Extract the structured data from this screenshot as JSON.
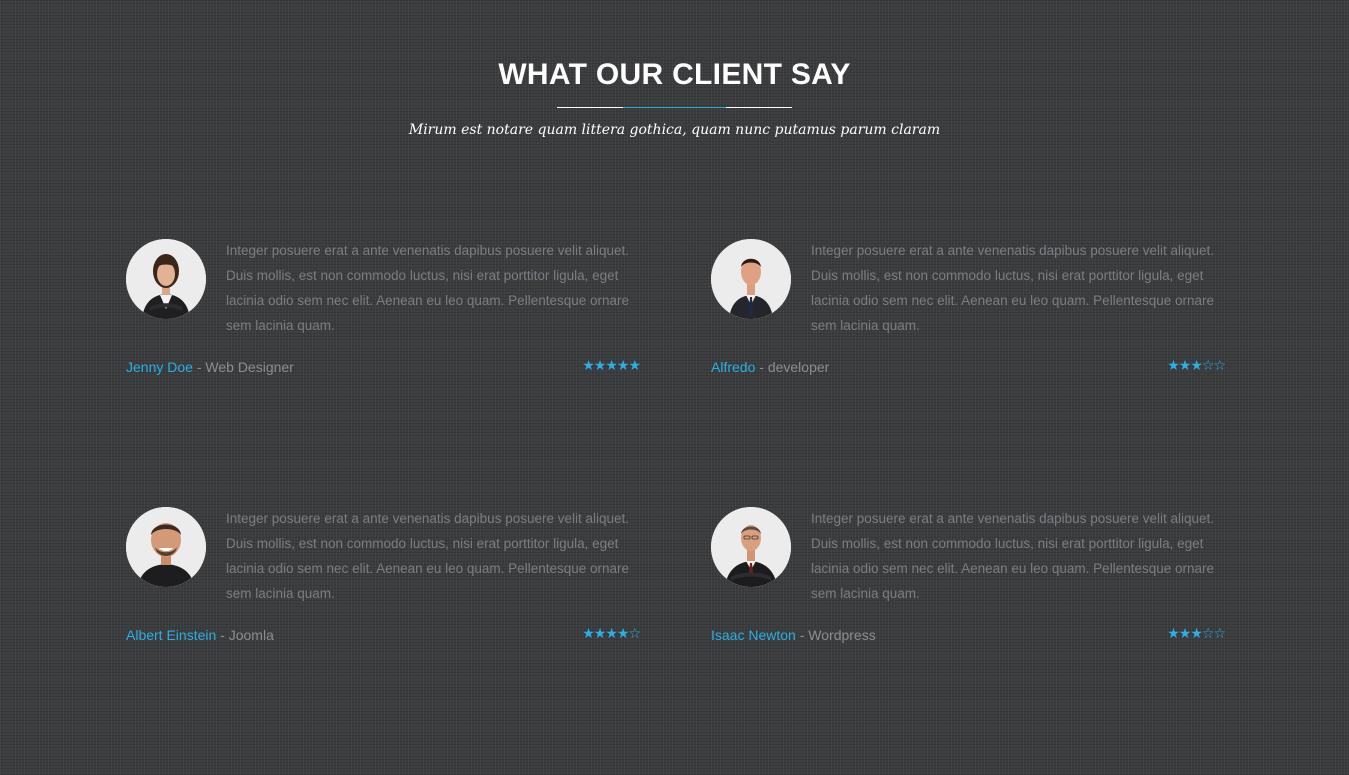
{
  "header": {
    "title": "WHAT OUR CLIENT SAY",
    "subtitle": "Mirum est notare quam littera gothica, quam nunc putamus parum claram"
  },
  "colors": {
    "accent": "#2ab0e4",
    "background": "#3b3c3e",
    "body_text": "#7a7e84"
  },
  "testimonials": [
    {
      "quote": "Integer posuere erat a ante venenatis dapibus posuere velit aliquet. Duis mollis, est non commodo luctus, nisi erat porttitor ligula, eget lacinia odio sem nec elit. Aenean eu leo quam. Pellentesque ornare sem lacinia quam.",
      "name": "Jenny Doe",
      "separator": " - ",
      "role": "Web Designer",
      "rating": 5,
      "rating_max": 5,
      "stars": "★★★★★",
      "avatar_icon": "businesswoman-avatar-icon"
    },
    {
      "quote": "Integer posuere erat a ante venenatis dapibus posuere velit aliquet. Duis mollis, est non commodo luctus, nisi erat porttitor ligula, eget lacinia odio sem nec elit. Aenean eu leo quam. Pellentesque ornare sem lacinia quam.",
      "name": "Alfredo",
      "separator": " - ",
      "role": "developer",
      "rating": 3,
      "rating_max": 5,
      "stars": "★★★☆☆",
      "avatar_icon": "businessman-suit-avatar-icon"
    },
    {
      "quote": "Integer posuere erat a ante venenatis dapibus posuere velit aliquet. Duis mollis, est non commodo luctus, nisi erat porttitor ligula, eget lacinia odio sem nec elit. Aenean eu leo quam. Pellentesque ornare sem lacinia quam.",
      "name": "Albert Einstein",
      "separator": " - ",
      "role": "Joomla",
      "rating": 4,
      "rating_max": 5,
      "stars": "★★★★☆",
      "avatar_icon": "smiling-man-avatar-icon"
    },
    {
      "quote": "Integer posuere erat a ante venenatis dapibus posuere velit aliquet. Duis mollis, est non commodo luctus, nisi erat porttitor ligula, eget lacinia odio sem nec elit. Aenean eu leo quam. Pellentesque ornare sem lacinia quam.",
      "name": "Isaac Newton",
      "separator": " - ",
      "role": "Wordpress",
      "rating": 3,
      "rating_max": 5,
      "stars": "★★★☆☆",
      "avatar_icon": "older-businessman-avatar-icon"
    }
  ]
}
